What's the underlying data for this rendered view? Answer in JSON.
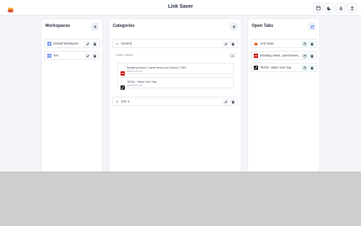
{
  "app": {
    "title": "Link Saver",
    "logo": "link-saver-logo-icon"
  },
  "topbar": {
    "actions": [
      {
        "name": "layout-icon"
      },
      {
        "name": "dark-mode-icon"
      },
      {
        "name": "download-icon"
      },
      {
        "name": "upload-icon"
      }
    ]
  },
  "workspaces": {
    "title": "Workspaces",
    "items": [
      {
        "label": "Default Workspace"
      },
      {
        "label": "test"
      }
    ]
  },
  "categories": {
    "title": "Categories",
    "items": [
      {
        "label": "General",
        "expanded": true,
        "subheader": "Links: 2 items",
        "links": [
          {
            "title": "Breaking News, Latest News and Videos | CNN",
            "url": "edition.cnn.com"
          },
          {
            "title": "TikTok - Make Your Day",
            "url": "www.tiktok.com"
          }
        ]
      },
      {
        "label": "test -1",
        "expanded": false
      }
    ]
  },
  "open_tabs": {
    "title": "Open Tabs",
    "items": [
      {
        "label": "Link Saver"
      },
      {
        "label": "Breaking News, Latest News..."
      },
      {
        "label": "TikTok - Make Your Day"
      }
    ]
  },
  "colors": {
    "accent": "#2563eb",
    "cnn": "#cc0000",
    "brand": "#e0533d"
  }
}
